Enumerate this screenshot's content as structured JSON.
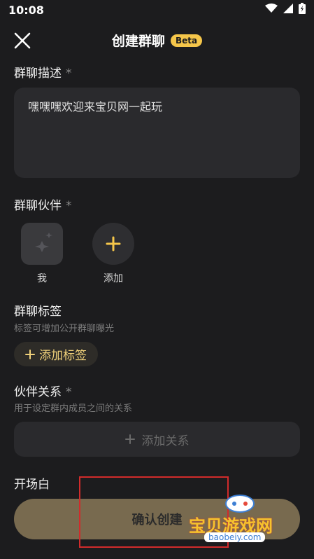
{
  "status_bar": {
    "time": "10:08"
  },
  "header": {
    "title": "创建群聊",
    "badge": "Beta"
  },
  "description": {
    "label": "群聊描述",
    "required_mark": "*",
    "value": "嘿嘿嘿欢迎来宝贝网一起玩"
  },
  "partners": {
    "label": "群聊伙伴",
    "required_mark": "*",
    "self_label": "我",
    "add_label": "添加"
  },
  "tags": {
    "label": "群聊标签",
    "hint": "标签可增加公开群聊曝光",
    "add_button": "添加标签"
  },
  "relations": {
    "label": "伙伴关系",
    "required_mark": "*",
    "hint": "用于设定群内成员之间的关系",
    "add_button": "添加关系"
  },
  "opening": {
    "label": "开场白"
  },
  "confirm": {
    "label": "确认创建"
  },
  "watermark": {
    "text": "宝贝游戏网",
    "url": "baobeiy.com"
  },
  "colors": {
    "background": "#1c1c1e",
    "accent": "#f5c64a",
    "confirm": "#786a4f"
  }
}
